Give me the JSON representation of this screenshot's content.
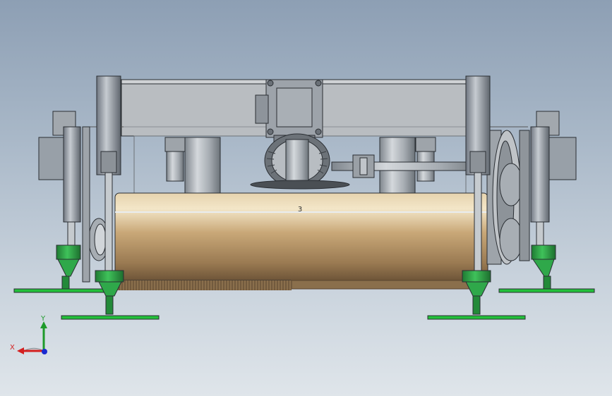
{
  "viewport": {
    "background_top": "#8d9fb4",
    "background_bottom": "#dfe5ea"
  },
  "model": {
    "frame_color": "#b8bcc0",
    "roller_color": "#c9a878",
    "foot_color": "#2fa84a",
    "pad_color": "#22c03a",
    "motor_color": "#a0a6ad",
    "roller_mark": "3"
  },
  "triad": {
    "x_label": "X",
    "y_label": "Y",
    "x_color": "#d42020",
    "y_color": "#1e9a2a",
    "z_color": "#1a2ad0"
  }
}
